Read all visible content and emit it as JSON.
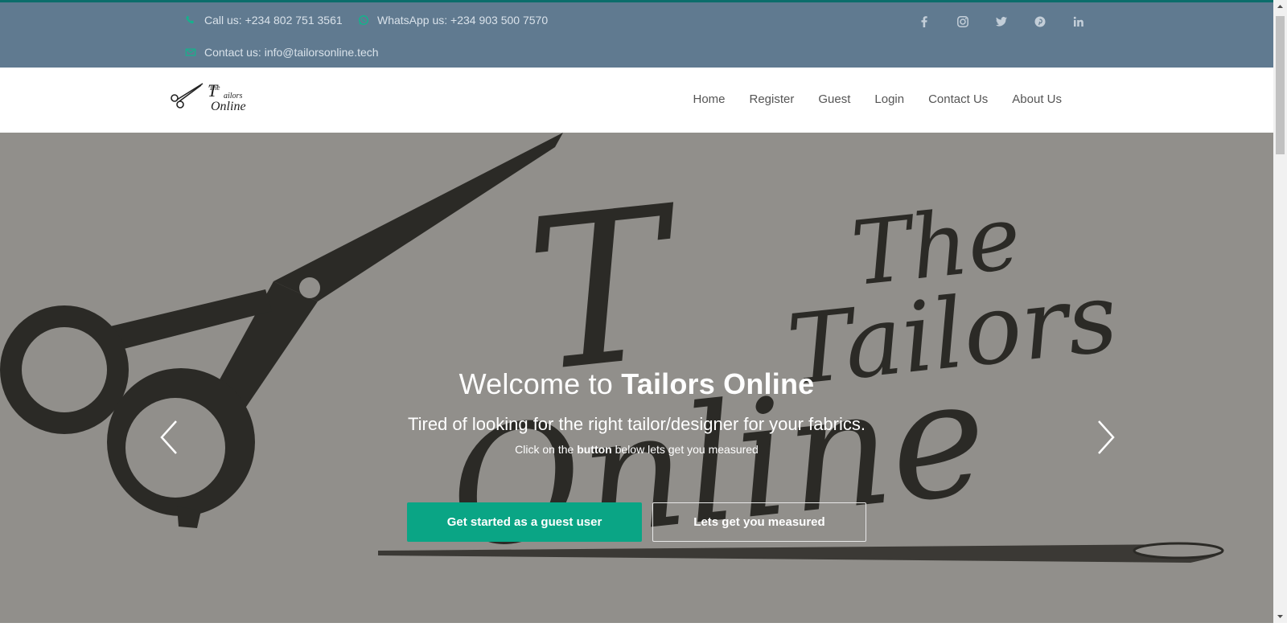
{
  "topbar": {
    "phone": "Call us: +234 802 751 3561",
    "whatsapp": "WhatsApp us: +234 903 500 7570",
    "email": "Contact us: info@tailorsonline.tech",
    "social": [
      "facebook-icon",
      "instagram-icon",
      "twitter-icon",
      "pinterest-icon",
      "linkedin-icon"
    ]
  },
  "logo": {
    "line1": "The",
    "line2": "ailors",
    "line3": "Online"
  },
  "nav": {
    "home": "Home",
    "register": "Register",
    "guest": "Guest",
    "login": "Login",
    "contact": "Contact Us",
    "about": "About Us"
  },
  "hero": {
    "art_words": {
      "the": "The",
      "tailors": "Tailors",
      "online": "Online"
    },
    "title_prefix": "Welcome to ",
    "title_brand": "Tailors Online",
    "subtitle": "Tired of looking for the right tailor/designer for your fabrics.",
    "small_prefix": "Click on the ",
    "small_bold": "button",
    "small_suffix": " below lets get you measured",
    "btn_guest": "Get started as a guest user",
    "btn_measure": "Lets get you measured"
  },
  "colors": {
    "topbar": "#607a90",
    "accent": "#0aa585",
    "hero_bg": "#918f8b",
    "art": "#2b2a26"
  }
}
